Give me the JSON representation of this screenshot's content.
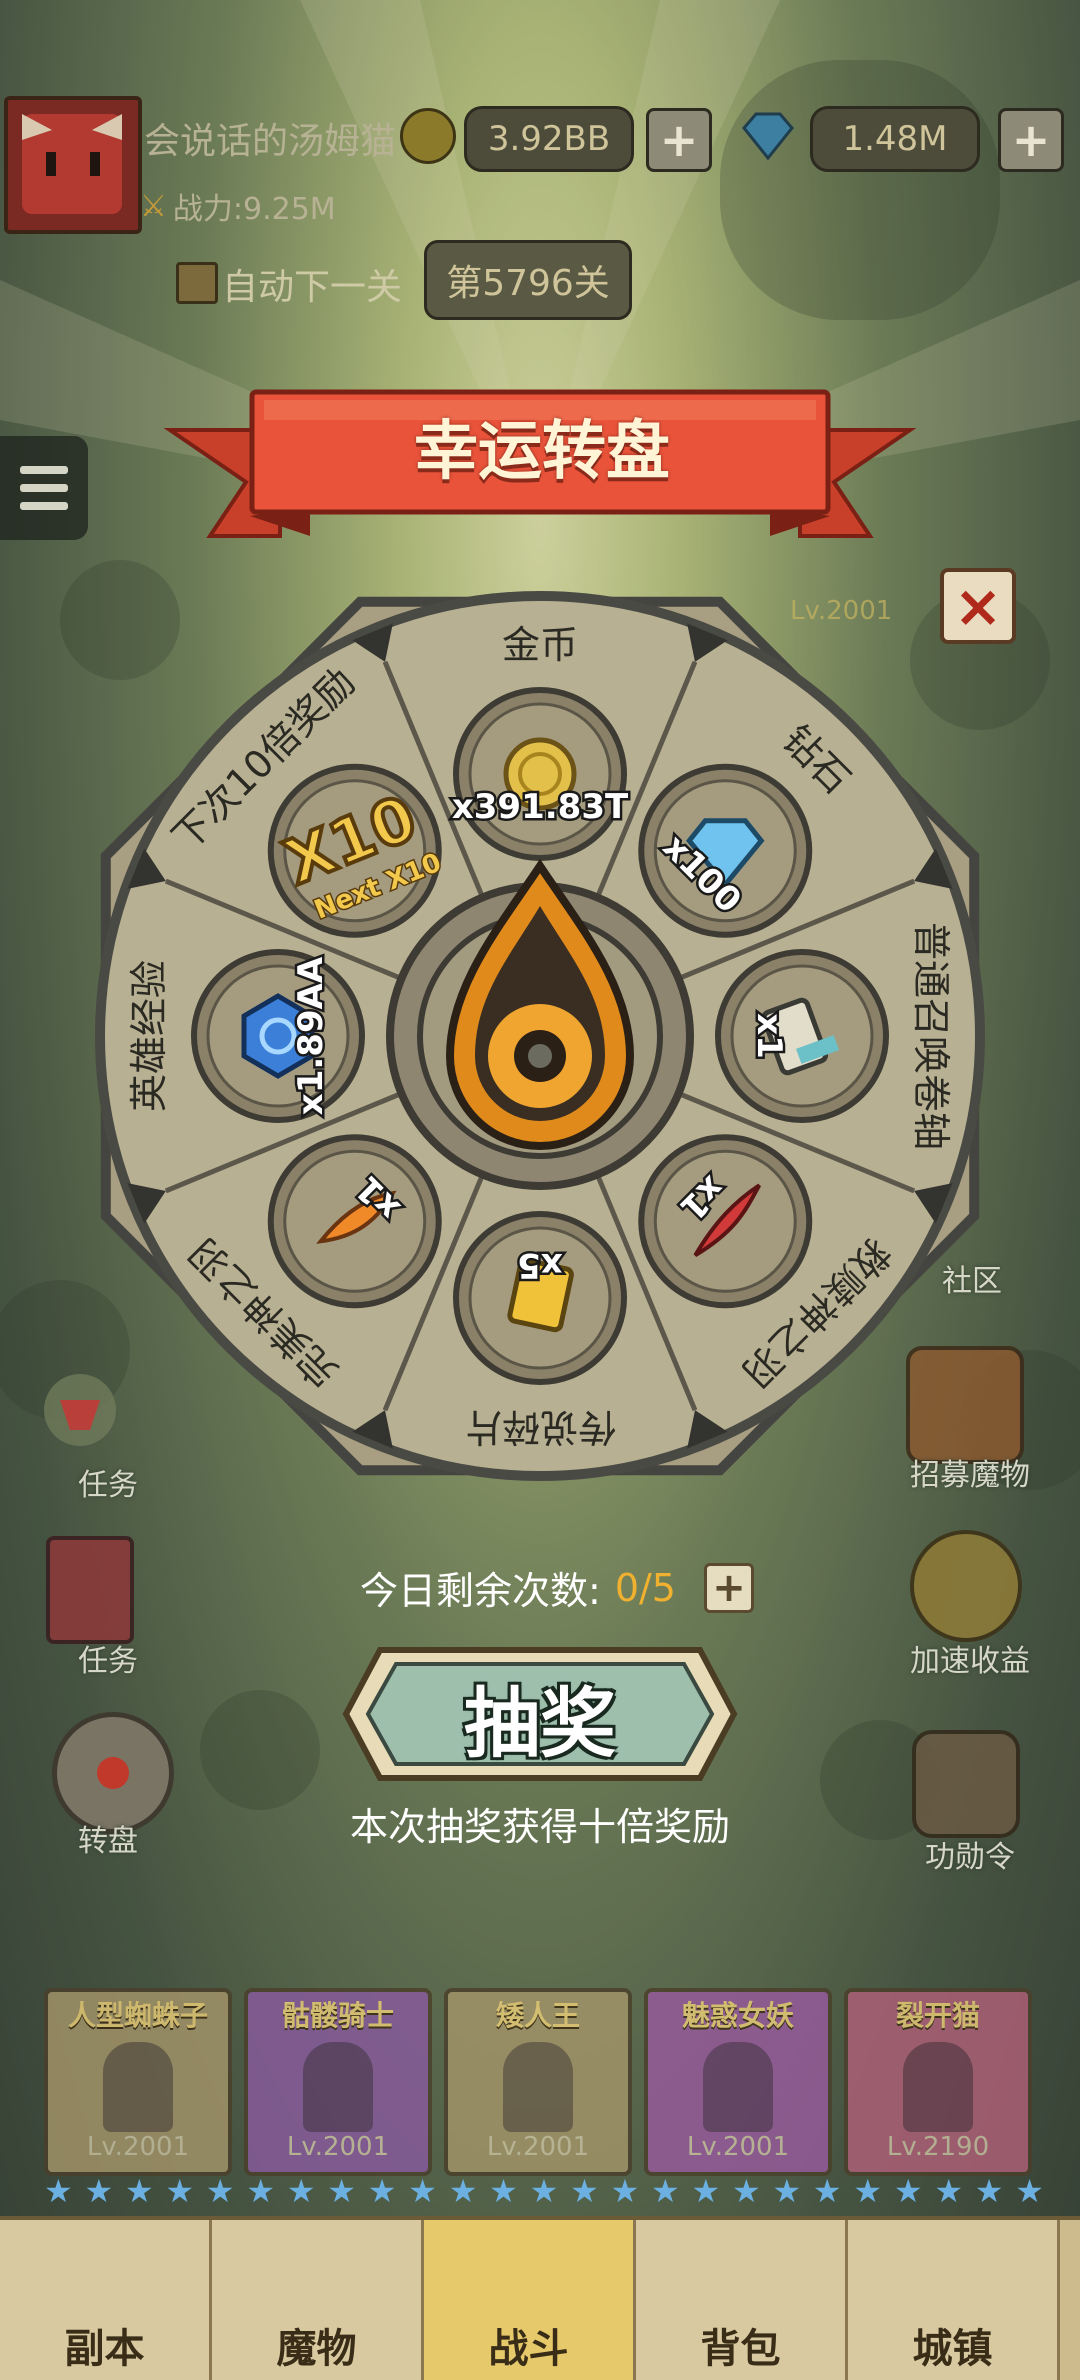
{
  "player": {
    "name": "会说话的汤姆猫",
    "power": "战力:9.25M",
    "gold": "3.92BB",
    "diamonds": "1.48M",
    "plus": "+"
  },
  "stage": {
    "auto_next_label": "自动下一关",
    "stage_label": "第5796关"
  },
  "wheel": {
    "title": "幸运转盘",
    "close": "×",
    "segments": [
      {
        "label": "金币",
        "value": "x391.83T",
        "icon": "gold-coin-icon"
      },
      {
        "label": "钻石",
        "value": "x100",
        "icon": "diamond-icon"
      },
      {
        "label": "普通召唤卷轴",
        "value": "x1",
        "icon": "scroll-icon"
      },
      {
        "label": "救赎神之羽",
        "value": "x1",
        "icon": "red-feather-icon"
      },
      {
        "label": "传说碎片",
        "value": "x5",
        "icon": "legend-fragment-icon"
      },
      {
        "label": "完美神之羽",
        "value": "x1",
        "icon": "orange-feather-icon"
      },
      {
        "label": "英雄经验",
        "value": "x1.89AA",
        "icon": "hero-exp-orb-icon"
      },
      {
        "label": "下次10倍奖励",
        "value": "x10",
        "sub": "Next X10",
        "icon": "x10-badge-icon"
      }
    ],
    "remaining_label": "今日剩余次数:",
    "remaining_value": "0/5",
    "draw_button": "抽奖",
    "draw_note": "本次抽奖获得十倍奖励"
  },
  "sidebar": {
    "left": [
      "任务",
      "任务",
      "转盘"
    ],
    "right": [
      "社区",
      "招募魔物",
      "加速收益",
      "功勋令"
    ]
  },
  "boss_level": "Lv.2001",
  "heroes": [
    {
      "name": "人型蜘蛛子",
      "level": "Lv.2001"
    },
    {
      "name": "骷髅骑士",
      "level": "Lv.2001"
    },
    {
      "name": "矮人王",
      "level": "Lv.2001"
    },
    {
      "name": "魅惑女妖",
      "level": "Lv.2001"
    },
    {
      "name": "裂开猫",
      "level": "Lv.2190"
    }
  ],
  "tabs": [
    "副本",
    "魔物",
    "战斗",
    "背包",
    "城镇"
  ],
  "colors": {
    "ribbon": "#e8533a",
    "wheel_face": "#b8b093",
    "wheel_border": "#4a4a44",
    "remaining_value": "#f0b030",
    "draw_button": "#9dbfac"
  }
}
